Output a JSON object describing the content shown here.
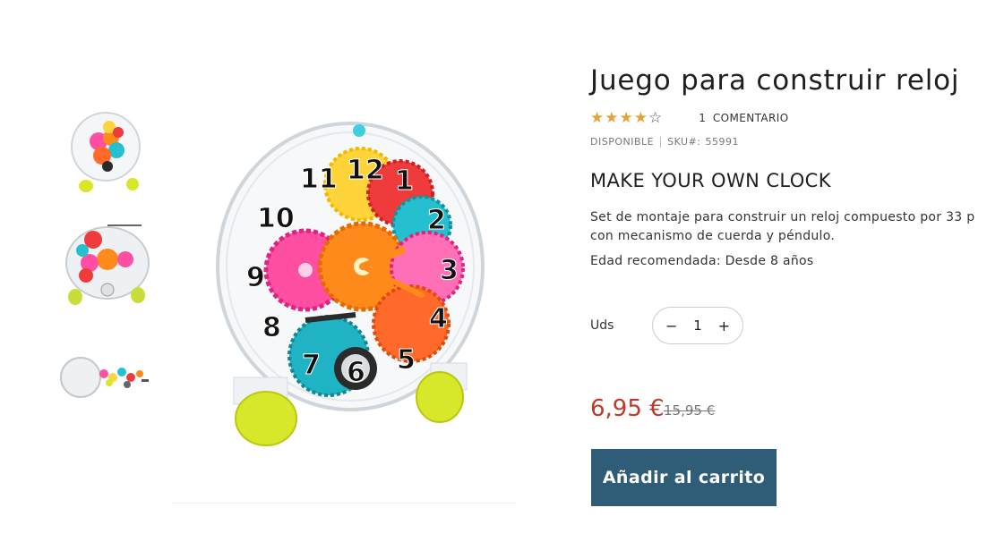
{
  "product": {
    "title": "Juego para construir reloj",
    "rating": {
      "value": 4,
      "max": 5,
      "count": "1",
      "label": "COMENTARIO"
    },
    "availability": "DISPONIBLE",
    "sku_label": "SKU#:",
    "sku_value": "55991",
    "subtitle": "MAKE YOUR OWN CLOCK",
    "description": "Set de montaje para construir un reloj compuesto por 33 p con mecanismo de cuerda y péndulo.",
    "age": "Edad recomendada: Desde 8 años",
    "price": "6,95 €",
    "old_price": "15,95 €"
  },
  "quantity": {
    "label": "Uds",
    "value": "1",
    "minus": "−",
    "plus": "+"
  },
  "cart_button": "Añadir al carrito",
  "clock_numbers": [
    "1",
    "2",
    "3",
    "4",
    "5",
    "6",
    "7",
    "8",
    "9",
    "10",
    "11",
    "12"
  ],
  "colors": {
    "price": "#c0392b",
    "button": "#2f5d78",
    "star": "#e2a432"
  },
  "icons": {
    "star_full": "★",
    "star_empty": "☆"
  }
}
